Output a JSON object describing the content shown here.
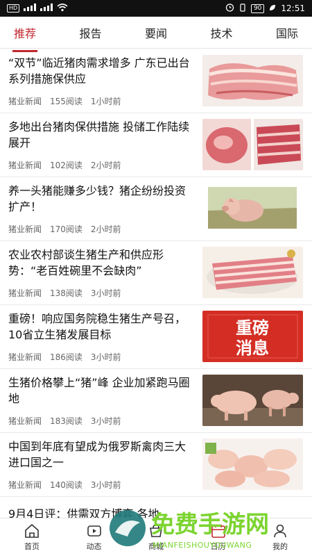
{
  "status_bar": {
    "left": [
      "HD",
      "4G",
      "4G"
    ],
    "battery": "90",
    "time": "12:51"
  },
  "tabs": [
    {
      "label": "推荐",
      "active": true
    },
    {
      "label": "报告",
      "active": false
    },
    {
      "label": "要闻",
      "active": false
    },
    {
      "label": "技术",
      "active": false
    },
    {
      "label": "国际",
      "active": false
    }
  ],
  "articles": [
    {
      "title": "“双节”临近猪肉需求增多 广东已出台系列措施保供应",
      "source": "猪业新闻",
      "reads": "155阅读",
      "time": "1小时前",
      "thumb": "pork-cuts-image"
    },
    {
      "title": "多地出台猪肉保供措施 投储工作陆续展开",
      "source": "猪业新闻",
      "reads": "102阅读",
      "time": "2小时前",
      "thumb": "pork-meat-image"
    },
    {
      "title": "养一头猪能赚多少钱？猪企纷纷投资扩产！",
      "source": "猪业新闻",
      "reads": "170阅读",
      "time": "2小时前",
      "thumb": "piglet-image"
    },
    {
      "title": "农业农村部谈生猪生产和供应形势：“老百姓碗里不会缺肉”",
      "source": "猪业新闻",
      "reads": "138阅读",
      "time": "3小时前",
      "thumb": "pork-belly-image"
    },
    {
      "title": "重磅！响应国务院稳生猪生产号召，10省立生猪发展目标",
      "source": "猪业新闻",
      "reads": "186阅读",
      "time": "3小时前",
      "thumb_text": "重磅\n消息",
      "thumb": "breaking-news-image"
    },
    {
      "title": "生猪价格攀上“猪”峰 企业加紧跑马圈地",
      "source": "猪业新闻",
      "reads": "183阅读",
      "time": "3小时前",
      "thumb": "pigs-image"
    },
    {
      "title": "中国到年底有望成为俄罗斯禽肉三大进口国之一",
      "source": "猪业新闻",
      "reads": "140阅读",
      "time": "3小时前",
      "thumb": "chicken-meat-image"
    }
  ],
  "partial_article": {
    "title": "9月4日评：供需双方博弈 各地"
  },
  "bottom_nav": [
    {
      "label": "首页",
      "icon": "home-icon"
    },
    {
      "label": "动态",
      "icon": "video-icon"
    },
    {
      "label": "商城",
      "icon": "shop-icon"
    },
    {
      "label": "日历",
      "icon": "calendar-icon"
    },
    {
      "label": "我的",
      "icon": "user-icon"
    }
  ],
  "watermark": {
    "text": "免费手游网",
    "sub": "MIANFEISHOUYOUWANG"
  }
}
